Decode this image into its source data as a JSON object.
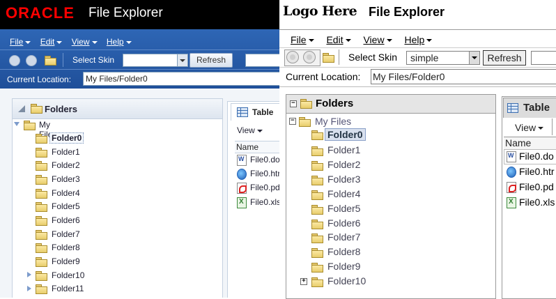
{
  "oracle_skin": {
    "brand_logo": "ORACLE",
    "app_title": "File Explorer",
    "menu": [
      "File",
      "Edit",
      "View",
      "Help"
    ],
    "select_skin_label": "Select Skin",
    "refresh_label": "Refresh",
    "current_location_label": "Current Location:",
    "current_location_value": "My Files/Folder0",
    "folders_panel_title": "Folders",
    "tree_root": "My Files",
    "tree_folders": [
      "Folder0",
      "Folder1",
      "Folder2",
      "Folder3",
      "Folder4",
      "Folder5",
      "Folder6",
      "Folder7",
      "Folder8",
      "Folder9",
      "Folder10",
      "Folder11"
    ],
    "tab_label": "Table",
    "view_menu_label": "View",
    "column_name": "Name",
    "files": [
      "File0.do",
      "File0.htr",
      "File0.pd",
      "File0.xls"
    ]
  },
  "simple_skin": {
    "brand_logo": "Logo Here",
    "app_title": "File Explorer",
    "menu": [
      "File",
      "Edit",
      "View",
      "Help"
    ],
    "select_skin_label": "Select Skin",
    "select_skin_value": "simple",
    "refresh_label": "Refresh",
    "current_location_label": "Current Location:",
    "current_location_value": "My Files/Folder0",
    "folders_panel_title": "Folders",
    "tree_root": "My Files",
    "tree_folders": [
      "Folder0",
      "Folder1",
      "Folder2",
      "Folder3",
      "Folder4",
      "Folder5",
      "Folder6",
      "Folder7",
      "Folder8",
      "Folder9",
      "Folder10"
    ],
    "tab_label": "Table",
    "view_menu_label": "View",
    "column_name": "Name",
    "files": [
      "File0.do",
      "File0.htr",
      "File0.pd",
      "File0.xls"
    ]
  },
  "colors": {
    "oracle_red": "#ff0000",
    "oracle_blue": "#2e66b5",
    "folder_yellow": "#f2d883"
  }
}
